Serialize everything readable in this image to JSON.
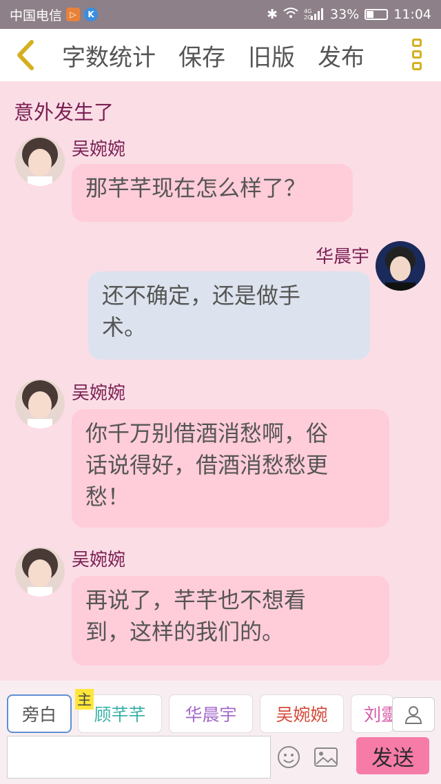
{
  "status_bar": {
    "carrier": "中国电信",
    "battery_percent": "33%",
    "battery_level": 0.33,
    "time": "11:04",
    "network": "4G/2G"
  },
  "toolbar": {
    "items": [
      "字数统计",
      "保存",
      "旧版",
      "发布"
    ]
  },
  "chat": {
    "scene_title": "意外发生了",
    "messages": [
      {
        "speaker": "吴婉婉",
        "text": "那芊芊现在怎么样了？"
      },
      {
        "speaker": "华晨宇",
        "text_line1": "还不确定，还是做手",
        "text_line2": "术。"
      },
      {
        "speaker": "吴婉婉",
        "text_line1": "你千万别借酒消愁啊，俗",
        "text_line2": "话说得好，借酒消愁愁更",
        "text_line3": "愁！"
      },
      {
        "speaker": "吴婉婉",
        "text_line1": "再说了，芊芊也不想看",
        "text_line2": "到，这样的我们的。"
      }
    ]
  },
  "characters": {
    "narrator": "旁白",
    "protagonist_badge": "主",
    "list": [
      {
        "name": "顾芊芊",
        "color": "#3bb0a8"
      },
      {
        "name": "华晨宇",
        "color": "#a56ac9"
      },
      {
        "name": "吴婉婉",
        "color": "#d64a3a"
      },
      {
        "name": "刘靈",
        "color": "#d85aa8"
      }
    ]
  },
  "composer": {
    "input_value": "",
    "send_label": "发送"
  },
  "colors": {
    "background": "#fbdde6",
    "name_color": "#7a1f52",
    "pink_bubble": "#ffccd9",
    "blue_bubble": "#dde3ee",
    "send_button": "#f77ba7"
  }
}
